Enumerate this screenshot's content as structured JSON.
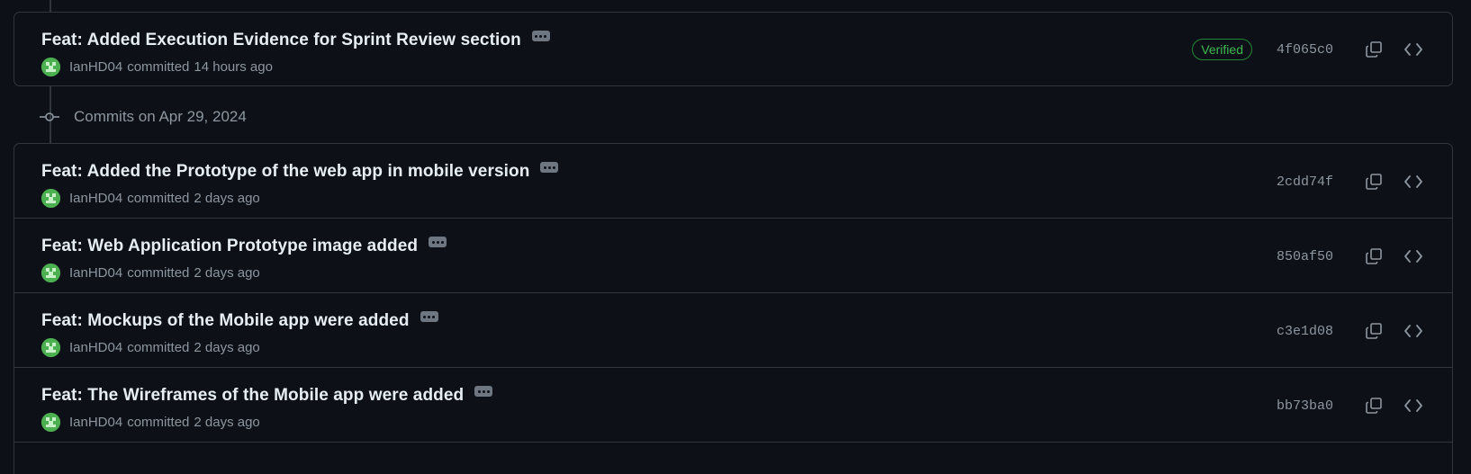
{
  "date_group": {
    "label": "Commits on Apr 29, 2024"
  },
  "commits_top": [
    {
      "title": "Feat: Added Execution Evidence for Sprint Review section",
      "author": "IanHD04",
      "committed_text": "committed",
      "time": "14 hours ago",
      "verified_label": "Verified",
      "sha": "4f065c0"
    }
  ],
  "commits_group": [
    {
      "title": "Feat: Added the Prototype of the web app in mobile version",
      "author": "IanHD04",
      "committed_text": "committed",
      "time": "2 days ago",
      "sha": "2cdd74f"
    },
    {
      "title": "Feat: Web Application Prototype image added",
      "author": "IanHD04",
      "committed_text": "committed",
      "time": "2 days ago",
      "sha": "850af50"
    },
    {
      "title": "Feat: Mockups of the Mobile app were added",
      "author": "IanHD04",
      "committed_text": "committed",
      "time": "2 days ago",
      "sha": "c3e1d08"
    },
    {
      "title": "Feat: The Wireframes of the Mobile app were added",
      "author": "IanHD04",
      "committed_text": "committed",
      "time": "2 days ago",
      "sha": "bb73ba0"
    }
  ],
  "colors": {
    "background": "#0d1117",
    "border": "#30363d",
    "verified": "#3fb950",
    "muted_text": "#8d96a0"
  }
}
